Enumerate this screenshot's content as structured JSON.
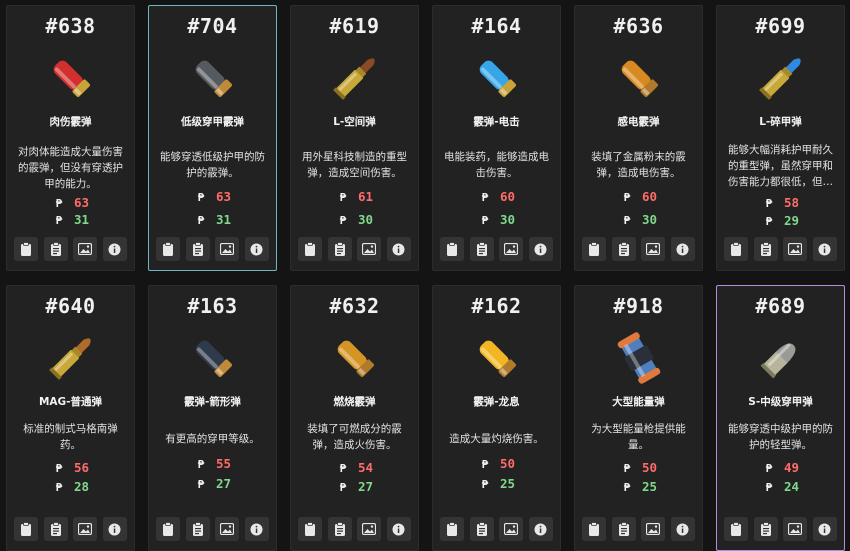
{
  "cards": [
    {
      "id": "#638",
      "name": "肉伤霰弹",
      "desc": "对肉体能造成大量伤害的霰弹，但没有穿透护甲的能力。",
      "damage": "63",
      "penetration": "31",
      "icon": "shell-red",
      "selected": ""
    },
    {
      "id": "#704",
      "name": "低级穿甲霰弹",
      "desc": "能够穿透低级护甲的防护的霰弹。",
      "damage": "63",
      "penetration": "31",
      "icon": "shell-grey",
      "selected": "blue"
    },
    {
      "id": "#619",
      "name": "L-空间弹",
      "desc": "用外星科技制造的重型弹，造成空间伤害。",
      "damage": "61",
      "penetration": "30",
      "icon": "rifle-brown",
      "selected": ""
    },
    {
      "id": "#164",
      "name": "霰弹-电击",
      "desc": "电能装药，能够造成电击伤害。",
      "damage": "60",
      "penetration": "30",
      "icon": "shell-blue",
      "selected": ""
    },
    {
      "id": "#636",
      "name": "感电霰弹",
      "desc": "装填了金属粉末的霰弹，造成电伤害。",
      "damage": "60",
      "penetration": "30",
      "icon": "shell-orange",
      "selected": ""
    },
    {
      "id": "#699",
      "name": "L-碎甲弹",
      "desc": "能够大幅消耗护甲耐久的重型弹，虽然穿甲和伤害能力都很低，但…",
      "damage": "58",
      "penetration": "29",
      "icon": "rifle-blue",
      "selected": ""
    },
    {
      "id": "#640",
      "name": "MAG-普通弹",
      "desc": "标准的制式马格南弹药。",
      "damage": "56",
      "penetration": "28",
      "icon": "rifle-copper",
      "selected": ""
    },
    {
      "id": "#163",
      "name": "霰弹-箭形弹",
      "desc": "有更高的穿甲等级。",
      "damage": "55",
      "penetration": "27",
      "icon": "shell-dark",
      "selected": ""
    },
    {
      "id": "#632",
      "name": "燃烧霰弹",
      "desc": "装填了可燃成分的霰弹，造成火伤害。",
      "damage": "54",
      "penetration": "27",
      "icon": "shell-amber",
      "selected": ""
    },
    {
      "id": "#162",
      "name": "霰弹-龙息",
      "desc": "造成大量灼烧伤害。",
      "damage": "50",
      "penetration": "25",
      "icon": "shell-yellow",
      "selected": ""
    },
    {
      "id": "#918",
      "name": "大型能量弹",
      "desc": "为大型能量枪提供能量。",
      "damage": "50",
      "penetration": "25",
      "icon": "energy-cell",
      "selected": ""
    },
    {
      "id": "#689",
      "name": "S-中级穿甲弹",
      "desc": "能够穿透中级护甲的防护的轻型弹。",
      "damage": "49",
      "penetration": "24",
      "icon": "pistol-round",
      "selected": "purple"
    }
  ],
  "actions": [
    "clipboard-icon",
    "clipboard-list-icon",
    "image-icon",
    "info-icon"
  ],
  "colors": {
    "damage": "#ff6b6b",
    "penetration": "#7fd88b",
    "card_bg": "#222222",
    "page_bg": "#141414",
    "selected_blue": "#6fb5c4",
    "selected_purple": "#b48ce6"
  }
}
